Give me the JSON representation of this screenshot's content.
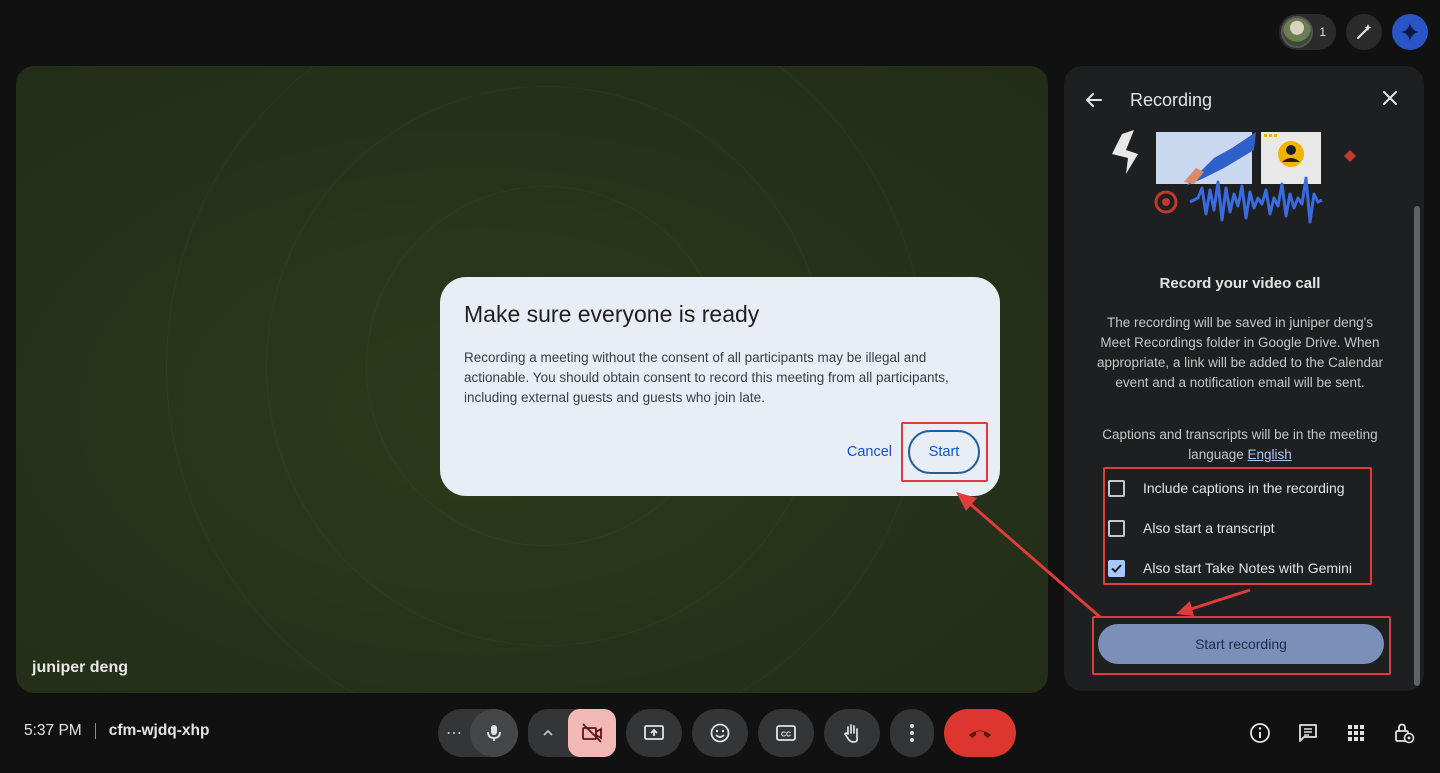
{
  "top_bar": {
    "participant_count": "1"
  },
  "tile": {
    "participant_name": "juniper deng"
  },
  "dialog": {
    "title": "Make sure everyone is ready",
    "body": "Recording a meeting without the consent of all participants may be illegal and actionable. You should obtain consent to record this meeting from all participants, including external guests and guests who join late.",
    "cancel_label": "Cancel",
    "start_label": "Start"
  },
  "panel": {
    "title": "Recording",
    "heading": "Record your video call",
    "description": "The recording will be saved in juniper deng's Meet Recordings folder in Google Drive. When appropriate, a link will be added to the Calendar event and a notification email will be sent.",
    "language_text": "Captions and transcripts will be in the meeting language",
    "language_link": "English",
    "options": [
      {
        "label": "Include captions in the recording",
        "checked": false
      },
      {
        "label": "Also start a transcript",
        "checked": false
      },
      {
        "label": "Also start Take Notes with Gemini",
        "checked": true
      }
    ],
    "start_recording_label": "Start recording"
  },
  "bottom": {
    "time": "5:37 PM",
    "meeting_code": "cfm-wjdq-xhp",
    "more_dots": "⋯"
  },
  "colors": {
    "accent": "#0b57d0",
    "hangup": "#dc362e",
    "camera_off": "#f2b8b5",
    "highlight_box": "#e03c3c"
  },
  "icons": [
    "pencil-sparkle-icon",
    "gemini-icon",
    "back-arrow-icon",
    "close-icon",
    "mic-icon",
    "chevron-up-icon",
    "camera-off-icon",
    "present-icon",
    "emoji-icon",
    "captions-icon",
    "raise-hand-icon",
    "more-vert-icon",
    "hangup-icon",
    "info-icon",
    "chat-icon",
    "activities-icon",
    "host-controls-icon"
  ]
}
